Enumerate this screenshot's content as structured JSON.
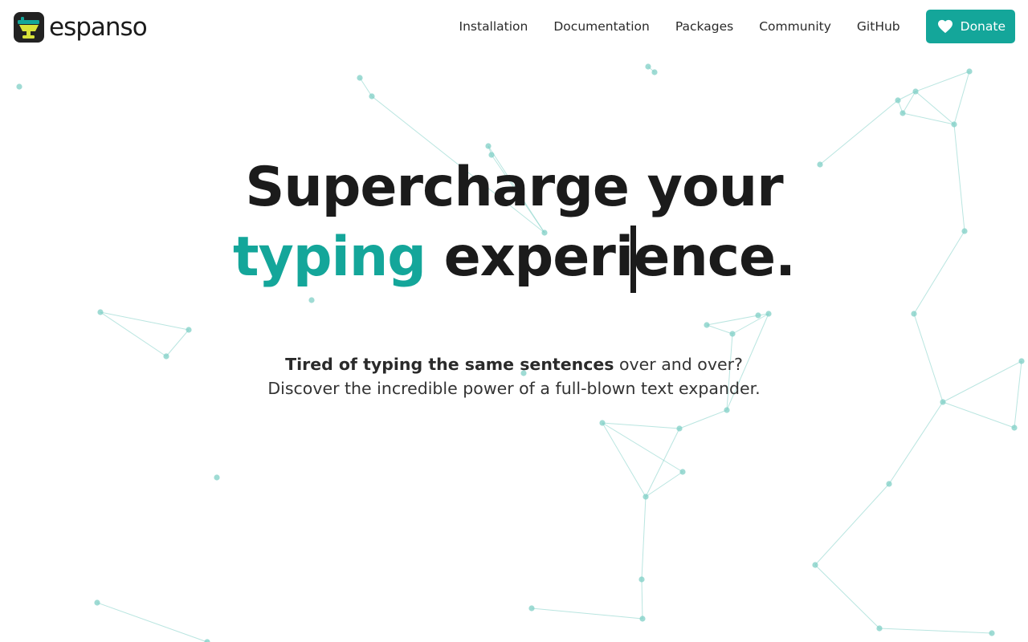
{
  "brand": {
    "name": "espanso",
    "logo_icon": "espanso-logo-icon"
  },
  "nav": {
    "links": [
      {
        "label": "Installation"
      },
      {
        "label": "Documentation"
      },
      {
        "label": "Packages"
      },
      {
        "label": "Community"
      },
      {
        "label": "GitHub"
      }
    ],
    "donate": {
      "label": "Donate",
      "icon": "heart-icon"
    }
  },
  "hero": {
    "title_line1": "Supercharge your",
    "title_accent": "typing",
    "title_rest_a": " experi",
    "title_rest_b": "ence.",
    "subtitle_bold": "Tired of typing the same sentences",
    "subtitle_rest": " over and over?",
    "subtitle_line2": "Discover the incredible power of a full-blown text expander."
  },
  "colors": {
    "accent": "#14a69a",
    "text": "#1b1b1b",
    "background": "#ffffff",
    "particle": "#7fcfc6"
  }
}
